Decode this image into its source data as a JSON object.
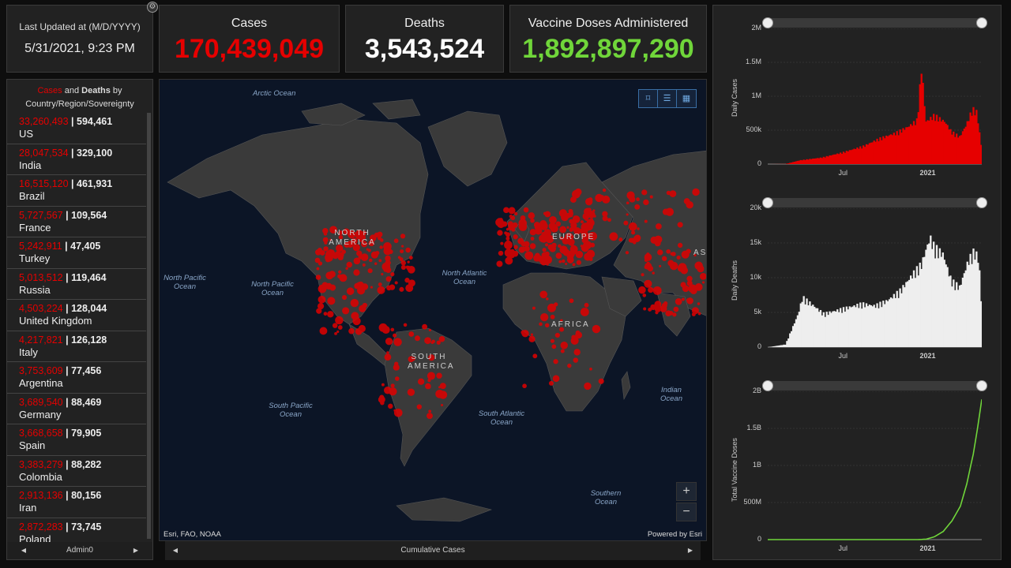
{
  "header": {
    "updated_label": "Last Updated at (M/D/YYYY)",
    "updated_value": "5/31/2021, 9:23 PM",
    "cases_title": "Cases",
    "cases_value": "170,439,049",
    "deaths_title": "Deaths",
    "deaths_value": "3,543,524",
    "vaccine_title": "Vaccine Doses Administered",
    "vaccine_value": "1,892,897,290",
    "colors": {
      "cases": "#e60000",
      "deaths": "#ffffff",
      "vaccine": "#70d63a"
    }
  },
  "list": {
    "title_red": "Cases",
    "title_rest": " and ",
    "title_bold": "Deaths",
    "title_tail": " by",
    "title_line2": "Country/Region/Sovereignty",
    "footer": "Admin0",
    "rows": [
      {
        "cases": "33,260,493",
        "deaths": "594,461",
        "name": "US"
      },
      {
        "cases": "28,047,534",
        "deaths": "329,100",
        "name": "India"
      },
      {
        "cases": "16,515,120",
        "deaths": "461,931",
        "name": "Brazil"
      },
      {
        "cases": "5,727,567",
        "deaths": "109,564",
        "name": "France"
      },
      {
        "cases": "5,242,911",
        "deaths": "47,405",
        "name": "Turkey"
      },
      {
        "cases": "5,013,512",
        "deaths": "119,464",
        "name": "Russia"
      },
      {
        "cases": "4,503,224",
        "deaths": "128,044",
        "name": "United Kingdom"
      },
      {
        "cases": "4,217,821",
        "deaths": "126,128",
        "name": "Italy"
      },
      {
        "cases": "3,753,609",
        "deaths": "77,456",
        "name": "Argentina"
      },
      {
        "cases": "3,689,540",
        "deaths": "88,469",
        "name": "Germany"
      },
      {
        "cases": "3,668,658",
        "deaths": "79,905",
        "name": "Spain"
      },
      {
        "cases": "3,383,279",
        "deaths": "88,282",
        "name": "Colombia"
      },
      {
        "cases": "2,913,136",
        "deaths": "80,156",
        "name": "Iran"
      },
      {
        "cases": "2,872,283",
        "deaths": "73,745",
        "name": "Poland"
      }
    ]
  },
  "map": {
    "labels": {
      "arctic": "Arctic Ocean",
      "north_pacific_left": "North Pacific Ocean",
      "north_pacific": "North Pacific Ocean",
      "north_atlantic": "North Atlantic Ocean",
      "south_pacific": "South Pacific Ocean",
      "south_atlantic": "South Atlantic Ocean",
      "indian": "Indian Ocean",
      "southern": "Southern Ocean",
      "north_america": "NORTH AMERICA",
      "south_america": "SOUTH AMERICA",
      "europe": "EUROPE",
      "africa": "AFRICA",
      "asia": "AS"
    },
    "attribution_left": "Esri, FAO, NOAA",
    "attribution_right": "Powered by Esri",
    "footer": "Cumulative Cases",
    "zoom_in": "+",
    "zoom_out": "−"
  },
  "chart_data": [
    {
      "type": "bar",
      "ylabel": "Daily Cases",
      "yticks": [
        "2M",
        "1.5M",
        "1M",
        "500k",
        "0"
      ],
      "xticks": [
        "Jul",
        "2021"
      ],
      "ylim": [
        0,
        2000000
      ],
      "color": "#e60000",
      "series_description_points": [
        [
          0,
          0
        ],
        [
          0.08,
          2000
        ],
        [
          0.15,
          60000
        ],
        [
          0.25,
          100000
        ],
        [
          0.35,
          180000
        ],
        [
          0.45,
          280000
        ],
        [
          0.52,
          390000
        ],
        [
          0.6,
          480000
        ],
        [
          0.66,
          580000
        ],
        [
          0.7,
          680000
        ],
        [
          0.72,
          1500000
        ],
        [
          0.74,
          650000
        ],
        [
          0.78,
          750000
        ],
        [
          0.83,
          650000
        ],
        [
          0.86,
          500000
        ],
        [
          0.9,
          420000
        ],
        [
          0.93,
          600000
        ],
        [
          0.96,
          850000
        ],
        [
          0.98,
          800000
        ],
        [
          1.0,
          300000
        ]
      ]
    },
    {
      "type": "bar",
      "ylabel": "Daily Deaths",
      "yticks": [
        "20k",
        "15k",
        "10k",
        "5k",
        "0"
      ],
      "xticks": [
        "Jul",
        "2021"
      ],
      "ylim": [
        0,
        20000
      ],
      "color": "#eeeeee",
      "series_description_points": [
        [
          0,
          0
        ],
        [
          0.08,
          400
        ],
        [
          0.14,
          5000
        ],
        [
          0.16,
          7500
        ],
        [
          0.2,
          6500
        ],
        [
          0.26,
          5000
        ],
        [
          0.32,
          5500
        ],
        [
          0.38,
          6000
        ],
        [
          0.44,
          6500
        ],
        [
          0.5,
          6200
        ],
        [
          0.56,
          7000
        ],
        [
          0.62,
          8500
        ],
        [
          0.68,
          11000
        ],
        [
          0.72,
          12500
        ],
        [
          0.76,
          16500
        ],
        [
          0.78,
          15000
        ],
        [
          0.82,
          14000
        ],
        [
          0.86,
          10000
        ],
        [
          0.9,
          9000
        ],
        [
          0.94,
          13000
        ],
        [
          0.97,
          14500
        ],
        [
          0.99,
          13000
        ],
        [
          1.0,
          7000
        ]
      ]
    },
    {
      "type": "line",
      "ylabel": "Total Vaccine Doses",
      "yticks": [
        "2B",
        "1.5B",
        "1B",
        "500M",
        "0"
      ],
      "xticks": [
        "Jul",
        "2021"
      ],
      "ylim": [
        0,
        2000000000
      ],
      "color": "#70d63a",
      "series_description_points": [
        [
          0,
          0
        ],
        [
          0.7,
          0
        ],
        [
          0.74,
          5000000
        ],
        [
          0.78,
          40000000
        ],
        [
          0.82,
          110000000
        ],
        [
          0.86,
          250000000
        ],
        [
          0.9,
          450000000
        ],
        [
          0.93,
          750000000
        ],
        [
          0.96,
          1150000000
        ],
        [
          0.98,
          1500000000
        ],
        [
          1.0,
          1890000000
        ]
      ]
    }
  ]
}
